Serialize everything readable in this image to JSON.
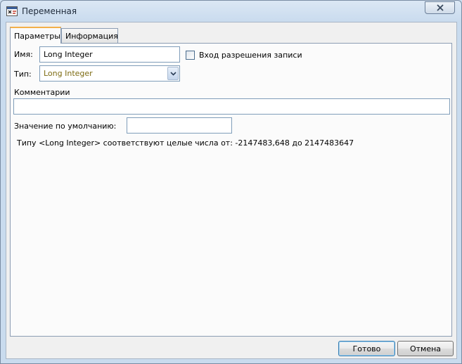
{
  "window": {
    "title": "Переменная",
    "icon": "variable-app-icon",
    "close_icon": "close-icon"
  },
  "tabs": [
    {
      "label": "Параметры",
      "active": true
    },
    {
      "label": "Информация",
      "active": false
    }
  ],
  "form": {
    "name_label": "Имя:",
    "name_value": "Long Integer",
    "write_access_label": "Вход разрешения записи",
    "write_access_checked": false,
    "type_label": "Тип:",
    "type_value": "Long Integer",
    "comments_label": "Комментарии",
    "comments_value": "",
    "default_label": "Значение по умолчанию:",
    "default_value": "",
    "info_text": "Типу <Long Integer> соответствуют целые числа от: -2147483,648 до 2147483647"
  },
  "buttons": {
    "ok_label": "Готово",
    "cancel_label": "Отмена"
  },
  "colors": {
    "active_tab_accent": "#f3b04a",
    "combo_text": "#7d6b12",
    "frame": "#c9dbee"
  }
}
